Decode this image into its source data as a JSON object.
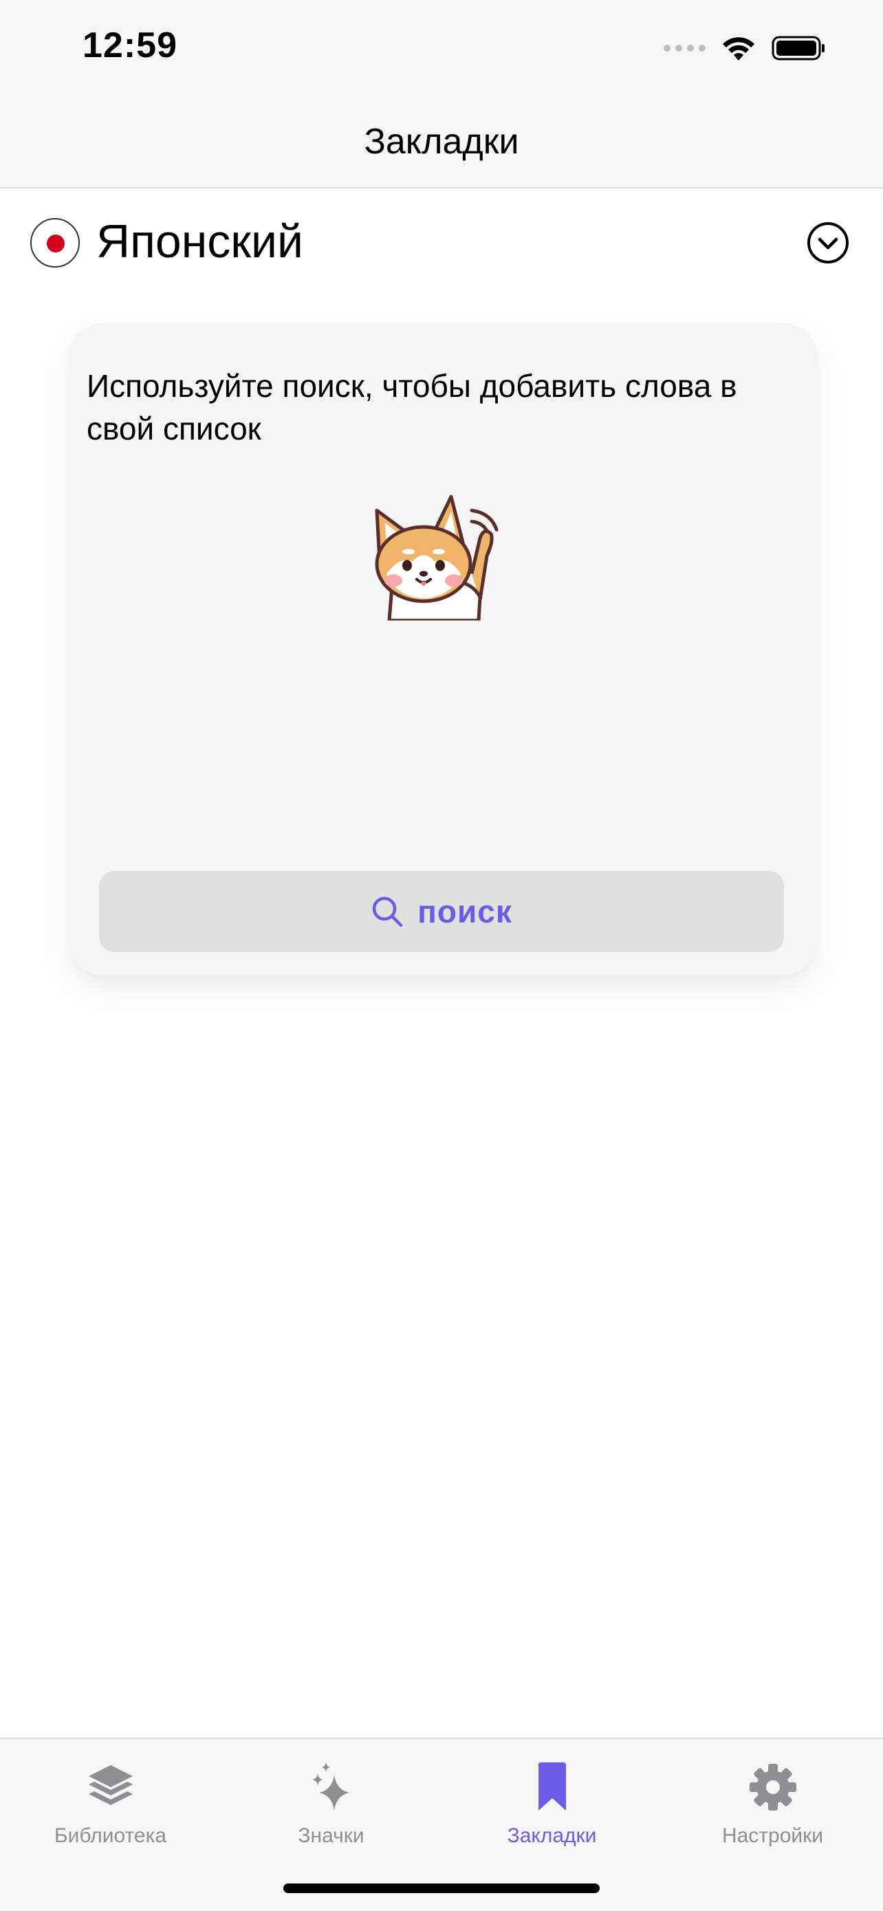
{
  "status_bar": {
    "time": "12:59"
  },
  "nav": {
    "title": "Закладки"
  },
  "language": {
    "name": "Японский"
  },
  "empty_state": {
    "message": "Используйте поиск, чтобы добавить слова в свой список",
    "search_label": "поиск"
  },
  "tabs": [
    {
      "label": "Библиотека",
      "icon": "stack-icon",
      "active": false
    },
    {
      "label": "Значки",
      "icon": "sparkles-icon",
      "active": false
    },
    {
      "label": "Закладки",
      "icon": "bookmark-icon",
      "active": true
    },
    {
      "label": "Настройки",
      "icon": "gear-icon",
      "active": false
    }
  ],
  "colors": {
    "accent": "#6b5ce7",
    "inactive": "#8e8e93",
    "flag_red": "#d3001d",
    "bar_bg": "#f6f6f6",
    "card_bg": "#f5f5f5"
  }
}
